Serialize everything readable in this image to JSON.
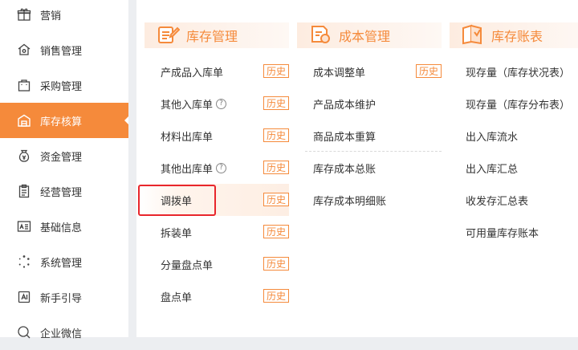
{
  "sidebar": {
    "items": [
      {
        "label": "营销",
        "icon": "gift-icon"
      },
      {
        "label": "销售管理",
        "icon": "house-icon"
      },
      {
        "label": "采购管理",
        "icon": "shopping-bag-icon"
      },
      {
        "label": "库存核算",
        "icon": "warehouse-icon",
        "active": true
      },
      {
        "label": "资金管理",
        "icon": "money-bag-icon"
      },
      {
        "label": "经营管理",
        "icon": "clipboard-icon"
      },
      {
        "label": "基础信息",
        "icon": "id-card-icon"
      },
      {
        "label": "系统管理",
        "icon": "loading-ring-icon"
      },
      {
        "label": "新手引导",
        "icon": "guide-doc-icon"
      },
      {
        "label": "企业微信",
        "icon": "chat-bubble-icon"
      }
    ]
  },
  "columns": [
    {
      "title": "库存管理",
      "icon": "clipboard-pencil-icon",
      "items": [
        {
          "label": "产成品入库单",
          "history": "历史"
        },
        {
          "label": "其他入库单",
          "help": "?",
          "history": "历史"
        },
        {
          "label": "材料出库单",
          "history": "历史"
        },
        {
          "label": "其他出库单",
          "help": "?",
          "history": "历史"
        },
        {
          "label": "调拨单",
          "history": "历史",
          "highlighted": true
        },
        {
          "label": "拆装单",
          "history": "历史"
        },
        {
          "label": "分量盘点单",
          "history": "历史"
        },
        {
          "label": "盘点单",
          "history": "历史"
        }
      ]
    },
    {
      "title": "成本管理",
      "icon": "cost-doc-icon",
      "items": [
        {
          "label": "成本调整单",
          "history": "历史"
        },
        {
          "label": "产品成本维护"
        },
        {
          "label": "商品成本重算"
        },
        {
          "label": "库存成本总账"
        },
        {
          "label": "库存成本明细账"
        }
      ]
    },
    {
      "title": "库存账表",
      "icon": "ledger-icon",
      "items": [
        {
          "label": "现存量（库存状况表）"
        },
        {
          "label": "现存量（库存分布表）"
        },
        {
          "label": "出入库流水"
        },
        {
          "label": "出入库汇总"
        },
        {
          "label": "收发存汇总表"
        },
        {
          "label": "可用量库存账本"
        }
      ]
    }
  ],
  "colors": {
    "accent": "#f58a3b",
    "highlight_box": "#e8262c"
  }
}
